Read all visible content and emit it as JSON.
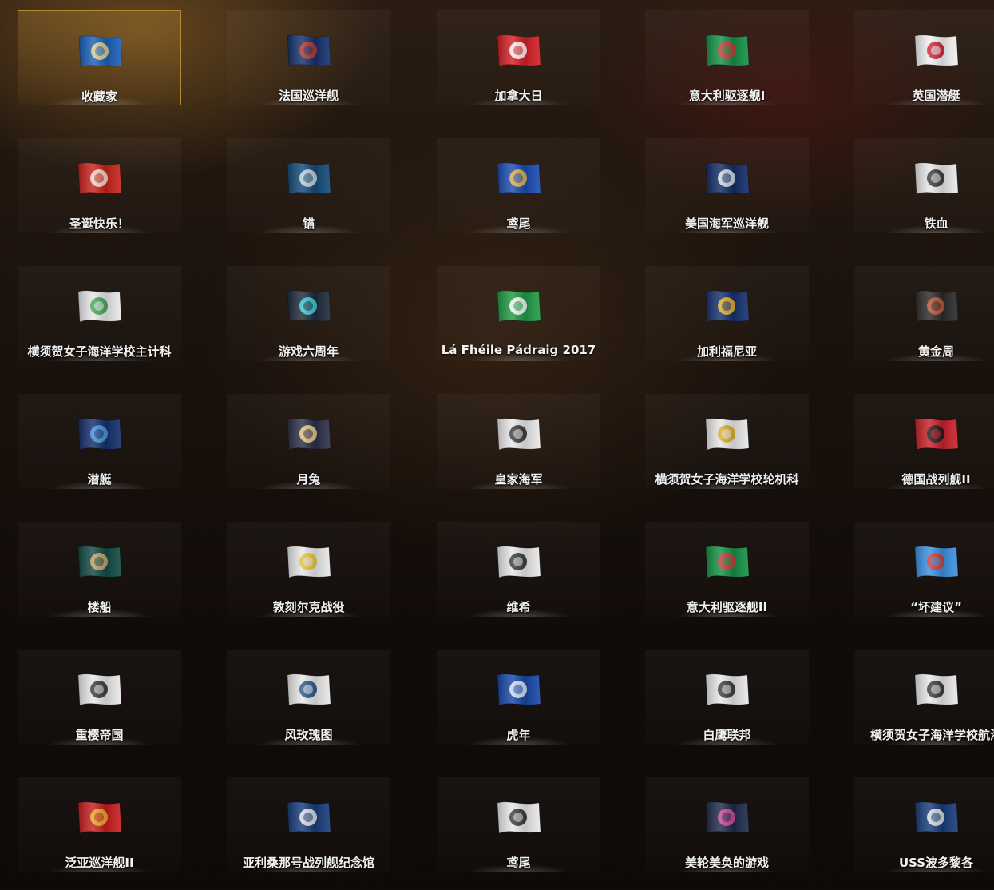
{
  "selected_index": 0,
  "items": [
    {
      "label": "收藏家",
      "icon": "collector-flag-icon",
      "colors": [
        "#1b5fb8",
        "#e8d58a"
      ]
    },
    {
      "label": "法国巡洋舰",
      "icon": "french-cruiser-flag-icon",
      "colors": [
        "#14306d",
        "#c0392b"
      ]
    },
    {
      "label": "加拿大日",
      "icon": "canada-day-flag-icon",
      "colors": [
        "#d41e24",
        "#ffffff"
      ]
    },
    {
      "label": "意大利驱逐舰I",
      "icon": "italian-destroyer-flag-icon",
      "colors": [
        "#149045",
        "#d8323a"
      ]
    },
    {
      "label": "英国潜艇",
      "icon": "british-submarine-flag-icon",
      "colors": [
        "#f2f2f2",
        "#c9152d"
      ]
    },
    {
      "label": "圣诞快乐！",
      "icon": "santa-claus-icon",
      "colors": [
        "#c8221b",
        "#f3e6da"
      ]
    },
    {
      "label": "锚",
      "icon": "anchor-flag-icon",
      "colors": [
        "#134a78",
        "#cfd8e0"
      ]
    },
    {
      "label": "鸢尾",
      "icon": "fleur-de-lis-flag-icon",
      "colors": [
        "#1a4bb2",
        "#e7b84a"
      ]
    },
    {
      "label": "美国海军巡洋舰",
      "icon": "us-navy-cruiser-flag-icon",
      "colors": [
        "#122b67",
        "#dde3ea"
      ]
    },
    {
      "label": "铁血",
      "icon": "iron-blood-flag-icon",
      "colors": [
        "#e8e8e8",
        "#2b2b2b"
      ]
    },
    {
      "label": "横须贺女子海洋学校主计科",
      "icon": "yokosuka-paymaster-flag-icon",
      "colors": [
        "#e8e8e8",
        "#3aa14a"
      ]
    },
    {
      "label": "游戏六周年",
      "icon": "sixth-anniversary-flag-icon",
      "colors": [
        "#1e2b3b",
        "#3fd3e0"
      ]
    },
    {
      "label": "Lá Fhéile Pádraig 2017",
      "icon": "shamrock-flag-icon",
      "colors": [
        "#1f9a43",
        "#ffffff"
      ]
    },
    {
      "label": "加利福尼亚",
      "icon": "california-flag-icon",
      "colors": [
        "#13306f",
        "#f0b62a"
      ]
    },
    {
      "label": "黄金周",
      "icon": "golden-week-flag-icon",
      "colors": [
        "#2a2a2a",
        "#c85a3a"
      ]
    },
    {
      "label": "潜艇",
      "icon": "submarine-flag-icon",
      "colors": [
        "#132f6a",
        "#4c9be0"
      ]
    },
    {
      "label": "月兔",
      "icon": "moon-rabbit-flag-icon",
      "colors": [
        "#2a2f46",
        "#f1cf8a"
      ]
    },
    {
      "label": "皇家海军",
      "icon": "royal-navy-flag-icon",
      "colors": [
        "#e8e8e8",
        "#2b2b2b"
      ]
    },
    {
      "label": "横须贺女子海洋学校轮机科",
      "icon": "yokosuka-engineering-flag-icon",
      "colors": [
        "#e8e8e8",
        "#d9a81e"
      ]
    },
    {
      "label": "德国战列舰II",
      "icon": "german-battleship-flag-icon",
      "colors": [
        "#c9202a",
        "#1a1a1a"
      ]
    },
    {
      "label": "楼船",
      "icon": "tower-ship-flag-icon",
      "colors": [
        "#124a45",
        "#d5a96a"
      ]
    },
    {
      "label": "敦刻尔克战役",
      "icon": "dunkirk-flag-icon",
      "colors": [
        "#e8e8e8",
        "#e7c02a"
      ]
    },
    {
      "label": "维希",
      "icon": "vichy-flag-icon",
      "colors": [
        "#e8e8e8",
        "#2b2b2b"
      ]
    },
    {
      "label": "意大利驱逐舰II",
      "icon": "italian-destroyer-flag-icon",
      "colors": [
        "#149045",
        "#d8323a"
      ]
    },
    {
      "label": "“坏建议”",
      "icon": "popcorn-flag-icon",
      "colors": [
        "#3b8fe0",
        "#d63a2e"
      ]
    },
    {
      "label": "重樱帝国",
      "icon": "sakura-empire-flag-icon",
      "colors": [
        "#e8e8e8",
        "#2b2b2b"
      ]
    },
    {
      "label": "风玫瑰图",
      "icon": "compass-rose-flag-icon",
      "colors": [
        "#e8e8e8",
        "#1c4a82"
      ]
    },
    {
      "label": "虎年",
      "icon": "tiger-year-flag-icon",
      "colors": [
        "#1747a8",
        "#dfe8f5"
      ]
    },
    {
      "label": "白鹰联邦",
      "icon": "eagle-union-flag-icon",
      "colors": [
        "#e8e8e8",
        "#2b2b2b"
      ]
    },
    {
      "label": "横须贺女子海洋学校航海",
      "icon": "yokosuka-navigation-flag-icon",
      "colors": [
        "#e8e8e8",
        "#2b2b2b"
      ]
    },
    {
      "label": "泛亚巡洋舰II",
      "icon": "pan-asian-cruiser-flag-icon",
      "colors": [
        "#c81d1d",
        "#e8b52a"
      ]
    },
    {
      "label": "亚利桑那号战列舰纪念馆",
      "icon": "arizona-memorial-flag-icon",
      "colors": [
        "#163b7a",
        "#e8e8e8"
      ]
    },
    {
      "label": "鸢尾",
      "icon": "fleur-de-lis-flag-icon",
      "colors": [
        "#e8e8e8",
        "#2b2b2b"
      ]
    },
    {
      "label": "美轮美奂的游戏",
      "icon": "hexagon-pattern-flag-icon",
      "colors": [
        "#1e2a4a",
        "#d84a9a"
      ]
    },
    {
      "label": "USS波多黎各",
      "icon": "puerto-rico-flag-icon",
      "colors": [
        "#163b7a",
        "#e8e8e8"
      ]
    }
  ]
}
